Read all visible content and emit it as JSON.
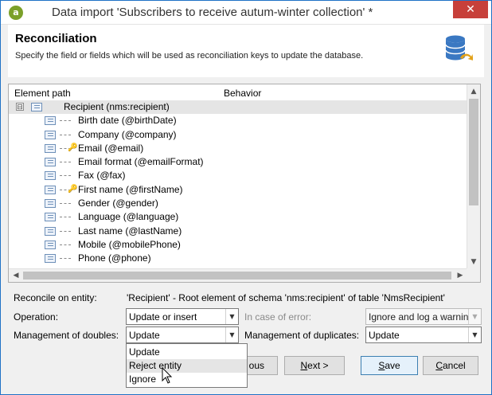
{
  "window": {
    "title": "Data import 'Subscribers to receive autum-winter collection' *",
    "app_icon": "adobe-campaign-icon",
    "close_glyph": "✕"
  },
  "header": {
    "title": "Reconciliation",
    "description": "Specify the field or fields which will be used as reconciliation keys to update the database.",
    "icon": "database-sync-icon"
  },
  "tree": {
    "columns": [
      "Element path",
      "Behavior"
    ],
    "root": {
      "label": "Recipient (nms:recipient)",
      "expander": "⊟"
    },
    "fields": [
      {
        "label": "Birth date (@birthDate)",
        "key": false
      },
      {
        "label": "Company (@company)",
        "key": false
      },
      {
        "label": "Email (@email)",
        "key": true
      },
      {
        "label": "Email format (@emailFormat)",
        "key": false
      },
      {
        "label": "Fax (@fax)",
        "key": false
      },
      {
        "label": "First name (@firstName)",
        "key": true
      },
      {
        "label": "Gender (@gender)",
        "key": false
      },
      {
        "label": "Language (@language)",
        "key": false
      },
      {
        "label": "Last name (@lastName)",
        "key": false
      },
      {
        "label": "Mobile (@mobilePhone)",
        "key": false
      },
      {
        "label": "Phone (@phone)",
        "key": false
      }
    ]
  },
  "form": {
    "reconcile_label": "Reconcile on entity:",
    "reconcile_value": "'Recipient' - Root element of schema 'nms:recipient' of table 'NmsRecipient'",
    "operation_label": "Operation:",
    "operation_value": "Update or insert",
    "error_label": "In case of error:",
    "error_value": "Ignore and log a warnin",
    "doubles_label": "Management of doubles:",
    "doubles_value": "Update",
    "duplicates_label": "Management of duplicates:",
    "duplicates_value": "Update",
    "doubles_options": [
      "Update",
      "Reject entity",
      "Ignore"
    ],
    "doubles_hover_index": 1
  },
  "buttons": {
    "previous_tail": "ous",
    "next_key": "N",
    "next_rest": "ext >",
    "save_key": "S",
    "save_rest": "ave",
    "cancel_key": "C",
    "cancel_rest": "ancel"
  }
}
